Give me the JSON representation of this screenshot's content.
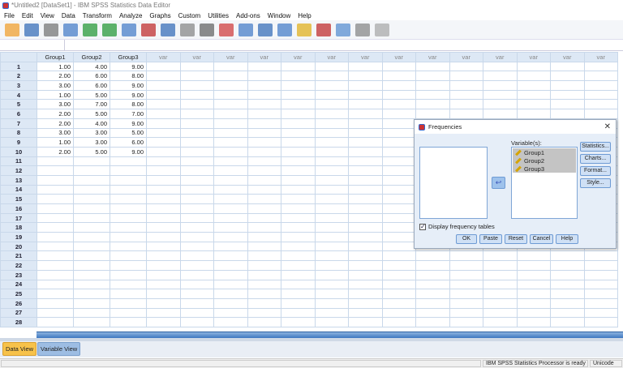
{
  "window": {
    "title": "*Untitled2 [DataSet1] - IBM SPSS Statistics Data Editor"
  },
  "menu": [
    "File",
    "Edit",
    "View",
    "Data",
    "Transform",
    "Analyze",
    "Graphs",
    "Custom",
    "Utilities",
    "Add-ons",
    "Window",
    "Help"
  ],
  "toolbar": [
    "open-icon",
    "save-icon",
    "print-icon",
    "recall-dialog-icon",
    "undo-icon",
    "redo-icon",
    "goto-case-icon",
    "goto-variable-icon",
    "variables-icon",
    "run-descriptives-icon",
    "find-icon",
    "insert-cases-icon",
    "insert-variable-icon",
    "split-file-icon",
    "weight-cases-icon",
    "select-cases-icon",
    "value-labels-icon",
    "use-sets-icon",
    "show-all-icon",
    "spell-icon"
  ],
  "grid": {
    "columns": [
      "Group1",
      "Group2",
      "Group3"
    ],
    "var_label": "var",
    "var_count": 14,
    "rows": [
      [
        "1.00",
        "4.00",
        "9.00"
      ],
      [
        "2.00",
        "6.00",
        "8.00"
      ],
      [
        "3.00",
        "6.00",
        "9.00"
      ],
      [
        "1.00",
        "5.00",
        "9.00"
      ],
      [
        "3.00",
        "7.00",
        "8.00"
      ],
      [
        "2.00",
        "5.00",
        "7.00"
      ],
      [
        "2.00",
        "4.00",
        "9.00"
      ],
      [
        "3.00",
        "3.00",
        "5.00"
      ],
      [
        "1.00",
        "3.00",
        "6.00"
      ],
      [
        "2.00",
        "5.00",
        "9.00"
      ]
    ],
    "total_rows": 28
  },
  "tabs": {
    "data_view": "Data View",
    "variable_view": "Variable View"
  },
  "status": {
    "processor": "IBM SPSS Statistics Processor is ready",
    "encoding": "Unicode"
  },
  "dialog": {
    "title": "Frequencies",
    "variables_label": "Variable(s):",
    "variables": [
      "Group1",
      "Group2",
      "Group3"
    ],
    "side_buttons": [
      "Statistics...",
      "Charts...",
      "Format...",
      "Style..."
    ],
    "display_freq_label": "Display frequency tables",
    "display_freq_checked": true,
    "buttons": [
      "OK",
      "Paste",
      "Reset",
      "Cancel",
      "Help"
    ]
  }
}
